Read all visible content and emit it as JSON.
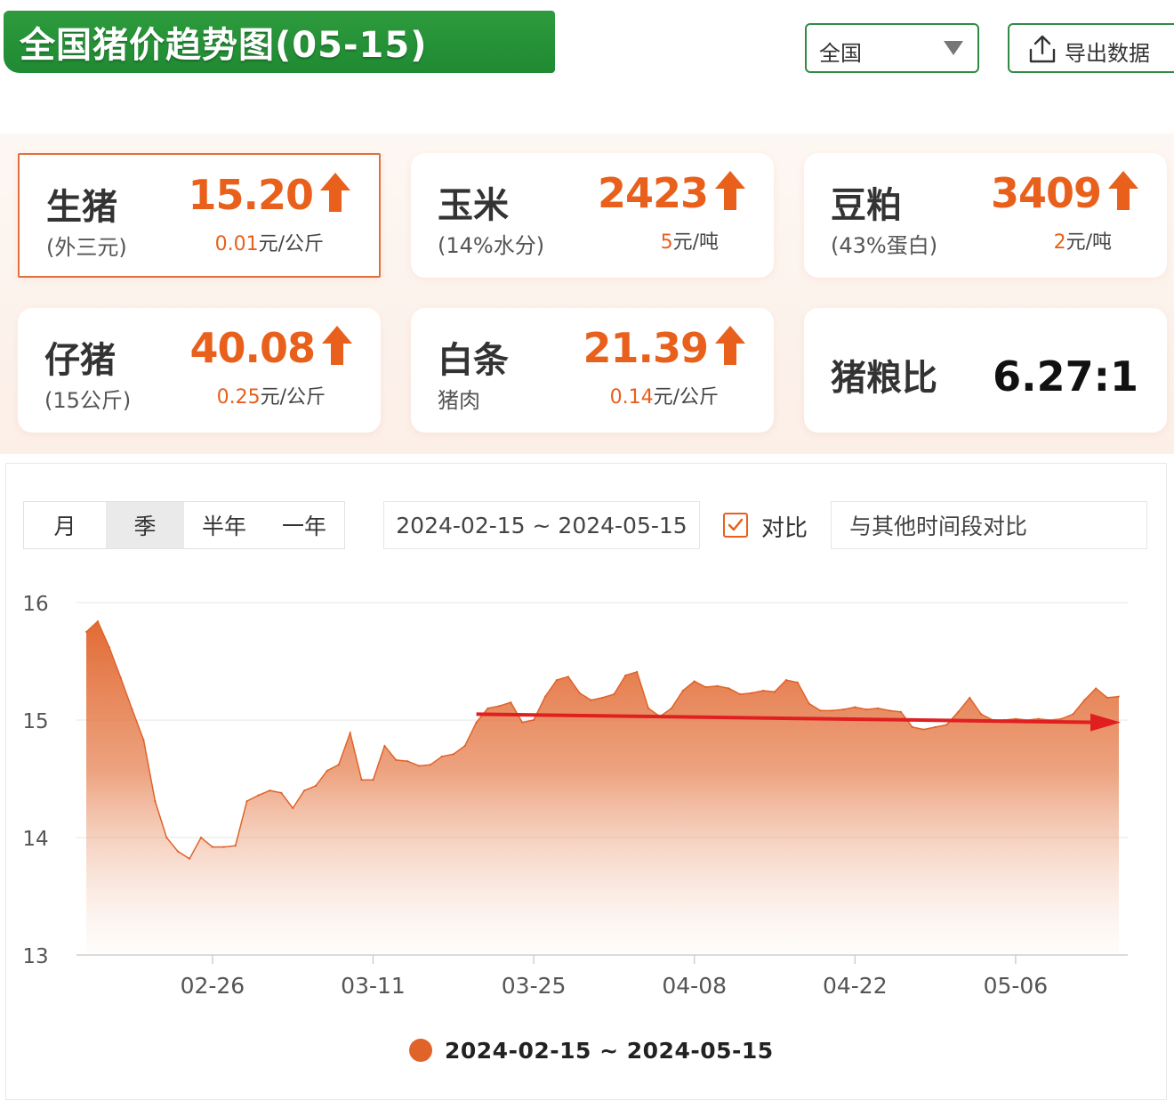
{
  "header": {
    "title": "全国猪价趋势图(05-15)",
    "region_selected": "全国",
    "export_label": "导出数据"
  },
  "cards": [
    {
      "name": "生猪",
      "sub": "(外三元)",
      "price": "15.20",
      "change": "0.01",
      "unit": "元/公斤",
      "trend": "up",
      "selected": true
    },
    {
      "name": "玉米",
      "sub": "(14%水分)",
      "price": "2423",
      "change": "5",
      "unit": "元/吨",
      "trend": "up",
      "selected": false
    },
    {
      "name": "豆粕",
      "sub": "(43%蛋白)",
      "price": "3409",
      "change": "2",
      "unit": "元/吨",
      "trend": "up",
      "selected": false
    },
    {
      "name": "仔猪",
      "sub": "(15公斤)",
      "price": "40.08",
      "change": "0.25",
      "unit": "元/公斤",
      "trend": "up",
      "selected": false
    },
    {
      "name": "白条",
      "sub": "猪肉",
      "price": "21.39",
      "change": "0.14",
      "unit": "元/公斤",
      "trend": "up",
      "selected": false
    }
  ],
  "ratio_card": {
    "name": "猪粮比",
    "value": "6.27:1"
  },
  "controls": {
    "periods": [
      "月",
      "季",
      "半年",
      "一年"
    ],
    "active_period": "季",
    "date_range": "2024-02-15 ~ 2024-05-15",
    "compare_label": "对比",
    "compare_checked": true,
    "compare_placeholder": "与其他时间段对比"
  },
  "colors": {
    "brand_green": "#2e9b3e",
    "accent_orange": "#e8601c",
    "area_fill": "#e0632a",
    "trend_arrow": "#e02020"
  },
  "chart_data": {
    "type": "area",
    "title": "",
    "xlabel": "",
    "ylabel": "",
    "ylim": [
      13,
      16
    ],
    "yticks": [
      13,
      14,
      15,
      16
    ],
    "xtick_labels": [
      "02-26",
      "03-11",
      "03-25",
      "04-08",
      "04-22",
      "05-06"
    ],
    "x_start": "2024-02-15",
    "grid": "horizontal",
    "legend_position": "bottom-center",
    "series": [
      {
        "name": "2024-02-15 ~ 2024-05-15",
        "x": [
          "02-15",
          "02-16",
          "02-17",
          "02-18",
          "02-19",
          "02-20",
          "02-21",
          "02-22",
          "02-23",
          "02-24",
          "02-25",
          "02-26",
          "02-27",
          "02-28",
          "02-29",
          "03-01",
          "03-02",
          "03-03",
          "03-04",
          "03-05",
          "03-06",
          "03-07",
          "03-08",
          "03-09",
          "03-10",
          "03-11",
          "03-12",
          "03-13",
          "03-14",
          "03-15",
          "03-16",
          "03-17",
          "03-18",
          "03-19",
          "03-20",
          "03-21",
          "03-22",
          "03-23",
          "03-24",
          "03-25",
          "03-26",
          "03-27",
          "03-28",
          "03-29",
          "03-30",
          "03-31",
          "04-01",
          "04-02",
          "04-03",
          "04-04",
          "04-05",
          "04-06",
          "04-07",
          "04-08",
          "04-09",
          "04-10",
          "04-11",
          "04-12",
          "04-13",
          "04-14",
          "04-15",
          "04-16",
          "04-17",
          "04-18",
          "04-19",
          "04-20",
          "04-21",
          "04-22",
          "04-23",
          "04-24",
          "04-25",
          "04-26",
          "04-27",
          "04-28",
          "04-29",
          "04-30",
          "05-01",
          "05-02",
          "05-03",
          "05-04",
          "05-05",
          "05-06",
          "05-07",
          "05-08",
          "05-09",
          "05-10",
          "05-11",
          "05-12",
          "05-13",
          "05-14",
          "05-15"
        ],
        "values": [
          15.75,
          15.84,
          15.62,
          15.36,
          15.09,
          14.83,
          14.31,
          14.0,
          13.88,
          13.82,
          14.0,
          13.92,
          13.92,
          13.93,
          14.31,
          14.36,
          14.4,
          14.38,
          14.25,
          14.4,
          14.44,
          14.57,
          14.62,
          14.89,
          14.49,
          14.49,
          14.78,
          14.66,
          14.65,
          14.61,
          14.62,
          14.69,
          14.71,
          14.78,
          14.98,
          15.1,
          15.12,
          15.15,
          14.98,
          15.0,
          15.2,
          15.34,
          15.37,
          15.23,
          15.17,
          15.19,
          15.22,
          15.38,
          15.41,
          15.1,
          15.03,
          15.1,
          15.25,
          15.33,
          15.28,
          15.29,
          15.27,
          15.22,
          15.23,
          15.25,
          15.24,
          15.34,
          15.32,
          15.14,
          15.08,
          15.08,
          15.09,
          15.11,
          15.09,
          15.1,
          15.08,
          15.07,
          14.94,
          14.92,
          14.94,
          14.96,
          15.07,
          15.19,
          15.05,
          15.0,
          15.0,
          15.01,
          15.0,
          15.01,
          15.0,
          15.01,
          15.05,
          15.17,
          15.27,
          15.19,
          15.2
        ]
      }
    ],
    "annotations": [
      {
        "type": "trend-arrow",
        "from": {
          "x": "03-20",
          "y": 15.05
        },
        "to": {
          "x": "05-15",
          "y": 14.98
        }
      }
    ]
  }
}
